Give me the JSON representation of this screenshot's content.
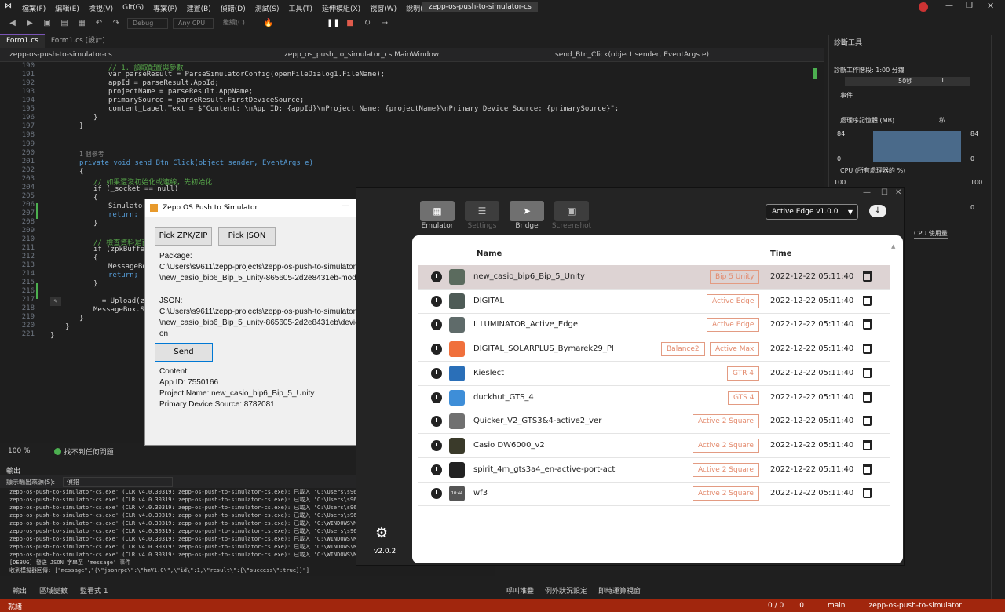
{
  "menubar": {
    "items": [
      "檔案(F)",
      "編輯(E)",
      "檢視(V)",
      "Git(G)",
      "專案(P)",
      "建置(B)",
      "偵錯(D)",
      "測試(S)",
      "工具(T)",
      "延伸模組(X)",
      "視窗(W)",
      "說明(H)",
      "搜尋"
    ],
    "solution_title": "zepp-os-push-to-simulator-cs"
  },
  "toolbar": {
    "config": "Debug",
    "platform": "Any CPU",
    "continue": "繼續(C)"
  },
  "tabs": [
    "Form1.cs",
    "Form1.cs [設計]"
  ],
  "navbar": {
    "project": "zepp-os-push-to-simulator-cs",
    "class": "zepp_os_push_to_simulator_cs.MainWindow",
    "member": "send_Btn_Click(object sender, EventArgs e)"
  },
  "code": {
    "line_numbers": [
      "190",
      "191",
      "192",
      "193",
      "194",
      "195",
      "196",
      "197",
      "198",
      "199",
      "200",
      "201",
      "202",
      "203",
      "204",
      "205",
      "206",
      "207",
      "208",
      "209",
      "210",
      "211",
      "212",
      "213",
      "214",
      "215",
      "216",
      "217",
      "218",
      "219",
      "220",
      "221"
    ],
    "l190": "// 1. 讀取配置與參數",
    "l191": "var parseResult = ParseSimulatorConfig(openFileDialog1.FileName);",
    "l192": "appId = parseResult.AppId;",
    "l193": "projectName = parseResult.AppName;",
    "l194": "primarySource = parseResult.FirstDeviceSource;",
    "l195": "content_Label.Text = $\"Content: \\nApp ID: {appId}\\nProject Name: {projectName}\\nPrimary Device Source: {primarySource}\";",
    "l196": "}",
    "l197": "}",
    "ref": "1 個參考",
    "l200": "private void send_Btn_Click(object sender, EventArgs e)",
    "l201": "{",
    "l202": "// 如果還沒初始化或連線，先初始化",
    "l203": "if (_socket == null)",
    "l204": "{",
    "l205": "Simulator",
    "l206": "return;",
    "l207": "}",
    "l209": "// 檢查資料是否",
    "l210": "if (zpkBuffer",
    "l211": "{",
    "l212": "MessageBox",
    "l213": "return;",
    "l214": "}",
    "l216": "_ = Upload(zpk",
    "l217": "MessageBox.Show",
    "l218": "}",
    "l219": "}",
    "l220": "}"
  },
  "editor_status": {
    "zoom": "100 %",
    "issues": "找不到任何問題"
  },
  "output": {
    "title": "輸出",
    "source_label": "顯示輸出來源(S):",
    "source_value": "偵錯",
    "lines": [
      "zepp-os-push-to-simulator-cs.exe' (CLR v4.0.30319: zepp-os-push-to-simulator-cs.exe): 已載入 'C:\\Users\\s9611\\zepp",
      "zepp-os-push-to-simulator-cs.exe' (CLR v4.0.30319: zepp-os-push-to-simulator-cs.exe): 已載入 'C:\\Users\\s9611\\zepp",
      "zepp-os-push-to-simulator-cs.exe' (CLR v4.0.30319: zepp-os-push-to-simulator-cs.exe): 已載入 'C:\\Users\\s9611\\zepp",
      "zepp-os-push-to-simulator-cs.exe' (CLR v4.0.30319: zepp-os-push-to-simulator-cs.exe): 已載入 'C:\\Users\\s9611\\zepp",
      "zepp-os-push-to-simulator-cs.exe' (CLR v4.0.30319: zepp-os-push-to-simulator-cs.exe): 已載入 'C:\\WINDOWS\\Micro",
      "zepp-os-push-to-simulator-cs.exe' (CLR v4.0.30319: zepp-os-push-to-simulator-cs.exe): 已載入 'C:\\Users\\s9611\\zepp",
      "zepp-os-push-to-simulator-cs.exe' (CLR v4.0.30319: zepp-os-push-to-simulator-cs.exe): 已載入 'C:\\WINDOWS\\Micro",
      "zepp-os-push-to-simulator-cs.exe' (CLR v4.0.30319: zepp-os-push-to-simulator-cs.exe): 已載入 'C:\\WINDOWS\\Micro",
      "zepp-os-push-to-simulator-cs.exe' (CLR v4.0.30319: zepp-os-push-to-simulator-cs.exe): 已載入 'C:\\WINDOWS\\Micro",
      "[DEBUG] 發送 JSON 字串至 'message' 事件",
      "收到模擬器回傳: [\"message\",\"{\\\"jsonrpc\\\":\\\"hmV1.0\\\",\\\"id\\\":1,\\\"result\\\":{\\\"success\\\":true}}\"]"
    ],
    "tabs": [
      "輸出",
      "區域變數",
      "監看式 1"
    ]
  },
  "right_bottom_tabs": [
    "呼叫堆疊",
    "例外狀況設定",
    "即時運算視窗"
  ],
  "diagnostics": {
    "title": "診斷工具",
    "session": "診斷工作階段: 1:00 分鐘",
    "tick": "50秒",
    "tick2": "1",
    "events": "事件",
    "memory": "處理序記憶體 (MB)",
    "mem_legend": "私...",
    "mem_max": "84",
    "mem_min": "0",
    "cpu": "CPU (所有處理器的 %)",
    "cpu_max": "100",
    "cpu_min": "0",
    "cpu_tab": "CPU 使用量"
  },
  "statusbar": {
    "state": "就緒",
    "changes": "0 / 0",
    "errors": "0",
    "branch": "main",
    "repo": "zepp-os-push-to-simulator"
  },
  "winform": {
    "title": "Zepp OS Push to Simulator",
    "pick_zpk": "Pick ZPK/ZIP",
    "pick_json": "Pick JSON",
    "package_label": "Package:",
    "package_path_1": "C:\\Users\\s9611\\zepp-projects\\zepp-os-push-to-simulator\\upload",
    "package_path_2": "\\new_casio_bip6_Bip_5_unity-865605-2d2e8431eb-mod.zip",
    "json_label": "JSON:",
    "json_path_1": "C:\\Users\\s9611\\zepp-projects\\zepp-os-push-to-simulator\\upload",
    "json_path_2": "\\new_casio_bip6_Bip_5_unity-865605-2d2e8431eb\\device\\app.js",
    "json_path_3": "on",
    "send": "Send",
    "content_label": "Content:",
    "app_id": "App ID: 7550166",
    "project_name": "Project Name: new_casio_bip6_Bip_5_Unity",
    "device_source": "Primary Device Source: 8782081"
  },
  "simulator": {
    "nav": [
      "Emulator",
      "Settings",
      "Bridge",
      "Screenshot"
    ],
    "device_select": "Active Edge v1.0.0",
    "version": "v2.0.2",
    "columns": {
      "name": "Name",
      "time": "Time"
    },
    "rows": [
      {
        "name": "new_casio_bip6_Bip_5_Unity",
        "tags": [
          "Bip 5 Unity"
        ],
        "time": "2022-12-22 05:11:40",
        "color": "#5b6b5e"
      },
      {
        "name": "DIGITAL",
        "tags": [
          "Active Edge"
        ],
        "time": "2022-12-22 05:11:40",
        "color": "#4e5b56"
      },
      {
        "name": "ILLUMINATOR_Active_Edge",
        "tags": [
          "Active Edge"
        ],
        "time": "2022-12-22 05:11:40",
        "color": "#5f6b6a"
      },
      {
        "name": "DIGITAL_SOLARPLUS_Bymarek29_PI",
        "tags": [
          "Balance2",
          "Active Max"
        ],
        "time": "2022-12-22 05:11:40",
        "color": "#f0703c"
      },
      {
        "name": "Kieslect",
        "tags": [
          "GTR 4"
        ],
        "time": "2022-12-22 05:11:40",
        "color": "#2a6fb8"
      },
      {
        "name": "duckhut_GTS_4",
        "tags": [
          "GTS 4"
        ],
        "time": "2022-12-22 05:11:40",
        "color": "#3e8ed8"
      },
      {
        "name": "Quicker_V2_GTS3&4-active2_ver",
        "tags": [
          "Active 2 Square"
        ],
        "time": "2022-12-22 05:11:40",
        "color": "#707070"
      },
      {
        "name": "Casio DW6000_v2",
        "tags": [
          "Active 2 Square"
        ],
        "time": "2022-12-22 05:11:40",
        "color": "#3a3a2a"
      },
      {
        "name": "spirit_4m_gts3a4_en-active-port-act",
        "tags": [
          "Active 2 Square"
        ],
        "time": "2022-12-22 05:11:40",
        "color": "#222222"
      },
      {
        "name": "wf3",
        "tags": [
          "Active 2 Square"
        ],
        "time": "2022-12-22 05:11:40",
        "color": "#555555",
        "thumb_text": "10:44"
      }
    ]
  }
}
